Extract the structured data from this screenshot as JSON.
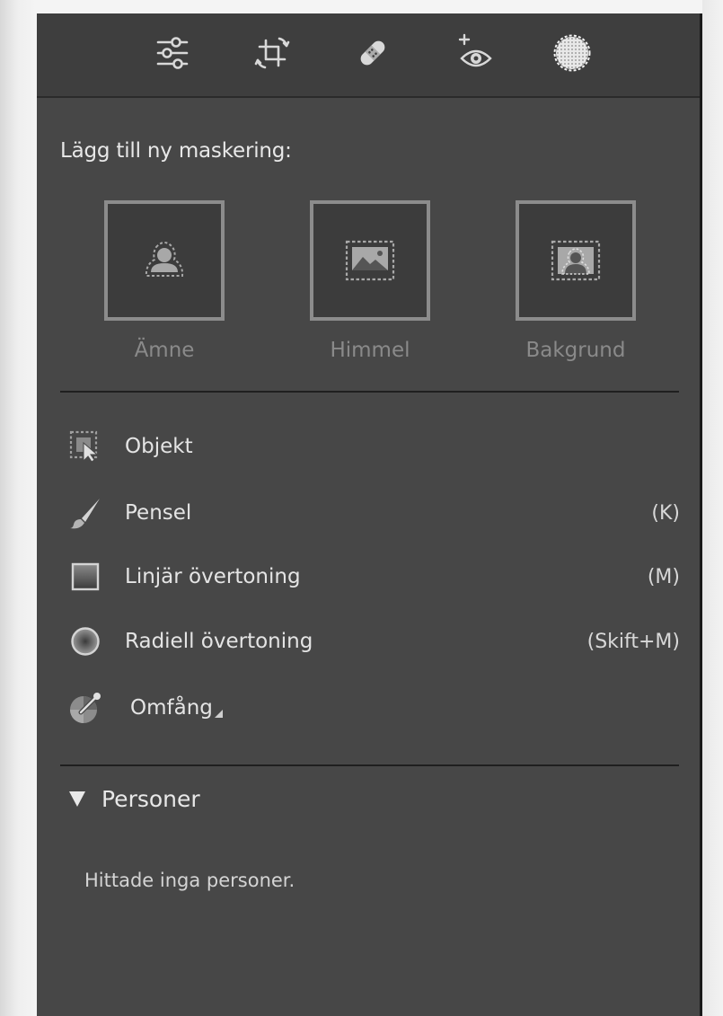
{
  "toolbar": {
    "tools": [
      {
        "name": "edit-sliders-icon",
        "active": false
      },
      {
        "name": "crop-icon",
        "active": false
      },
      {
        "name": "heal-icon",
        "active": false
      },
      {
        "name": "red-eye-icon",
        "active": false
      },
      {
        "name": "masking-icon",
        "active": true
      }
    ]
  },
  "masking": {
    "heading": "Lägg till ny maskering:",
    "quick_masks": [
      {
        "label": "Ämne",
        "icon": "subject-mask-icon"
      },
      {
        "label": "Himmel",
        "icon": "sky-mask-icon"
      },
      {
        "label": "Bakgrund",
        "icon": "background-mask-icon"
      }
    ],
    "tools": [
      {
        "label": "Objekt",
        "shortcut": "",
        "icon": "object-select-icon"
      },
      {
        "label": "Pensel",
        "shortcut": "(K)",
        "icon": "brush-icon"
      },
      {
        "label": "Linjär övertoning",
        "shortcut": "(M)",
        "icon": "linear-gradient-icon"
      },
      {
        "label": "Radiell övertoning",
        "shortcut": "(Skift+M)",
        "icon": "radial-gradient-icon"
      },
      {
        "label": "Omfång",
        "shortcut": "",
        "icon": "range-icon"
      }
    ]
  },
  "people": {
    "title": "Personer",
    "empty_message": "Hittade inga personer."
  },
  "colors": {
    "panel": "#474747",
    "toolbar": "#3e3e3e",
    "text": "#e4e4e4",
    "dim_text": "#8a8a8a"
  }
}
